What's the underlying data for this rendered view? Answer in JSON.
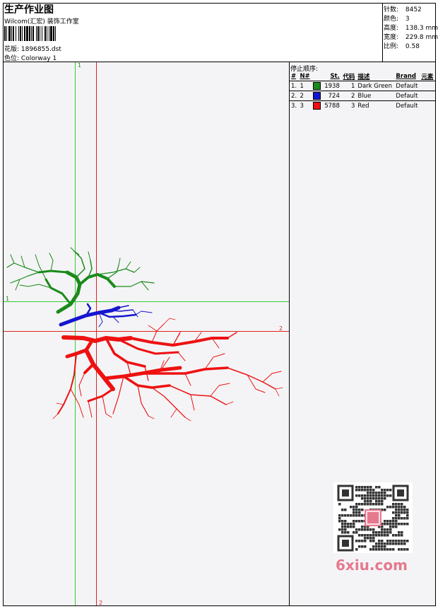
{
  "header": {
    "title": "生产作业图",
    "company": "Wilcom(汇宏) 装饰工作室",
    "design_label": "花版:",
    "design_file": "1896855.dst",
    "colorway_label": "色位:",
    "colorway": "Colorway 1"
  },
  "stats": [
    {
      "label": "针数:",
      "value": "8452"
    },
    {
      "label": "颜色:",
      "value": "3"
    },
    {
      "label": "高度:",
      "value": "138.3 mm"
    },
    {
      "label": "宽度:",
      "value": "229.8 mm"
    },
    {
      "label": "比例:",
      "value": "0.58"
    }
  ],
  "stop_panel": {
    "title": "停止顺序:",
    "columns": [
      "#",
      "N#",
      "St.",
      "代码",
      "描述",
      "Brand",
      "元素"
    ],
    "rows": [
      {
        "index": "1.",
        "n": "1",
        "stitches": "1938",
        "code": "1",
        "description": "Dark Green",
        "brand": "Default",
        "color": "#1a8a1a"
      },
      {
        "index": "2.",
        "n": "2",
        "stitches": "724",
        "code": "2",
        "description": "Blue",
        "brand": "Default",
        "color": "#1515d0"
      },
      {
        "index": "3.",
        "n": "3",
        "stitches": "5788",
        "code": "3",
        "description": "Red",
        "brand": "Default",
        "color": "#ee1111"
      }
    ]
  },
  "axis_labels": {
    "green_v": "1",
    "green_h": "1",
    "red_h": "2",
    "red_v": "2"
  },
  "colors": {
    "green": "#1a8a1a",
    "blue": "#1515d0",
    "red": "#ee1111",
    "guide_green": "#33cc33",
    "guide_red": "#dd2222"
  },
  "watermark": "6xiu.com"
}
